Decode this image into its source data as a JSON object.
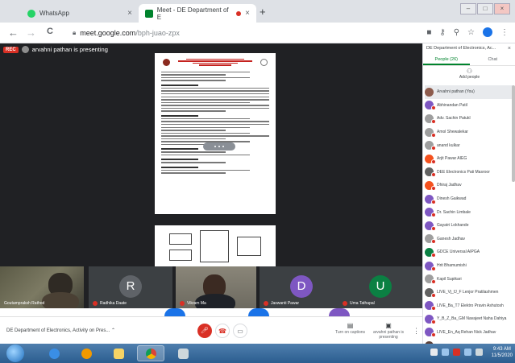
{
  "tabs": [
    {
      "label": "WhatsApp",
      "close": "×"
    },
    {
      "label": "Meet - DE Department of E",
      "close": "×"
    }
  ],
  "new_tab": "+",
  "nav": {
    "back": "←",
    "forward": "→",
    "reload": "C"
  },
  "address": {
    "host": "meet.google.com",
    "path": "/bph-juao-zpx"
  },
  "presenting": {
    "rec": "REC",
    "text": "arvahni pathan is presenting"
  },
  "participants_tiles": [
    {
      "name": "Goutampraksh Rathod",
      "initial": ""
    },
    {
      "name": "Radhika Daate",
      "initial": "R"
    },
    {
      "name": "Vikram Ma",
      "initial": ""
    },
    {
      "name": "Jaswanti Pawar",
      "initial": "D"
    },
    {
      "name": "Uma Tathapal",
      "initial": "U"
    }
  ],
  "bottom_bar": {
    "meeting_name": "DE Department of Electronics, Activity on Pres...",
    "captions_label": "Turn on captions",
    "present_label": "arvahni pathan is presenting"
  },
  "panel": {
    "title": "DE Department of Electronics, Ac...",
    "tab_people": "People (26)",
    "tab_chat": "Chat",
    "add_people": "Add people",
    "people": [
      {
        "name": "Arvahni pathan (You)",
        "color": "#8d5b4c"
      },
      {
        "name": "Abhinandan Patil",
        "color": "#7e57c2"
      },
      {
        "name": "Adv. Sachin Patukl",
        "color": "#9e9e9e"
      },
      {
        "name": "Amol Shewalekar",
        "color": "#9e9e9e"
      },
      {
        "name": "anand kulkar",
        "color": "#9e9e9e"
      },
      {
        "name": "Arjit Pawar AIEG",
        "color": "#f4511e"
      },
      {
        "name": "DEE Electronics Pati Masroor",
        "color": "#616161"
      },
      {
        "name": "Dhiraj Jadhav",
        "color": "#f4511e"
      },
      {
        "name": "Dinesh Gaikwad",
        "color": "#7e57c2"
      },
      {
        "name": "Dr. Sachin Limbale",
        "color": "#7e57c2"
      },
      {
        "name": "Gayatri Lokhande",
        "color": "#7e57c2"
      },
      {
        "name": "Ganesh Jadhav",
        "color": "#9e9e9e"
      },
      {
        "name": "GDCE Universal AIPGA",
        "color": "#0b8043"
      },
      {
        "name": "Hrit Bhamumishi",
        "color": "#7e57c2"
      },
      {
        "name": "Kapil Supikari",
        "color": "#9e9e9e"
      },
      {
        "name": "LIVE_Vj_fJ_F Lenjor Pratilashmen",
        "color": "#616161"
      },
      {
        "name": "LIVE_Ba_T7 Elektro Pravin Ashutosh",
        "color": "#7e57c2"
      },
      {
        "name": "Y_B_Z_Ba_GM Navajeet Naha Dahiya",
        "color": "#7e57c2"
      },
      {
        "name": "LIVE_En_Aq Rehan Nick Jadhav",
        "color": "#7e57c2"
      },
      {
        "name": "Mahesh Sawant",
        "color": "#5d4037"
      },
      {
        "name": "Manohar Kamble",
        "color": "#f4511e"
      }
    ]
  },
  "clock": {
    "time": "9:43 AM",
    "date": "11/5/2020"
  },
  "colors": {
    "meet_green": "#00832d",
    "alert_red": "#d93025",
    "stage_bg": "#202124"
  }
}
